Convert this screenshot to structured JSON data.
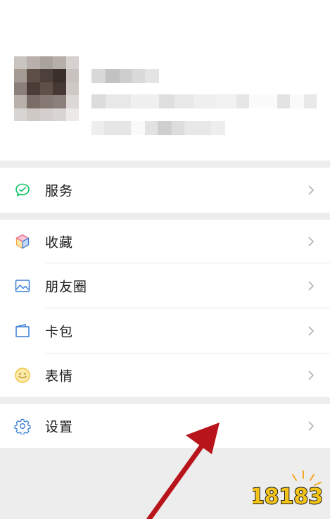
{
  "profile": {
    "avatar_label": "avatar",
    "name_label": "name",
    "account_label": "account"
  },
  "menu": {
    "services": {
      "label": "服务",
      "icon": "services-icon"
    },
    "favorites": {
      "label": "收藏",
      "icon": "favorites-icon"
    },
    "moments": {
      "label": "朋友圈",
      "icon": "moments-icon"
    },
    "cards": {
      "label": "卡包",
      "icon": "cards-icon"
    },
    "stickers": {
      "label": "表情",
      "icon": "stickers-icon"
    },
    "settings": {
      "label": "设置",
      "icon": "settings-icon"
    }
  },
  "colors": {
    "green": "#07c160",
    "blue": "#3a7ed5",
    "yellow": "#f0c23c",
    "arrow_red": "#b8141b",
    "background": "#ededed"
  },
  "watermark": {
    "text": "18183"
  }
}
